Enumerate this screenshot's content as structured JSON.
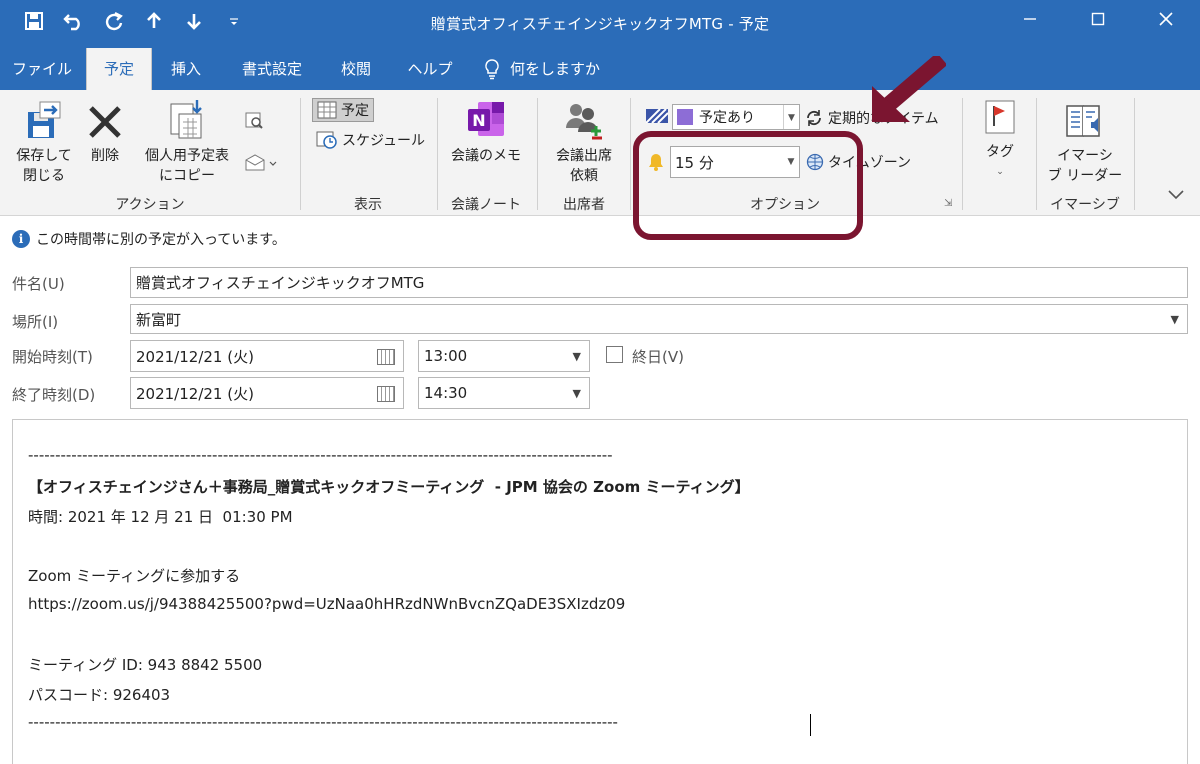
{
  "titlebar": {
    "title": "贈賞式オフィスチェインジキックオフMTG  -  予定",
    "qat_icons": [
      "save-icon",
      "undo-icon",
      "redo-icon",
      "up-arrow-icon",
      "down-arrow-icon",
      "customize-qat-icon"
    ]
  },
  "tabs": [
    {
      "label": "ファイル"
    },
    {
      "label": "予定"
    },
    {
      "label": "挿入"
    },
    {
      "label": "書式設定"
    },
    {
      "label": "校閲"
    },
    {
      "label": "ヘルプ"
    },
    {
      "label": "何をしますか"
    }
  ],
  "ribbon": {
    "actions": {
      "save_close": "保存して\n閉じる",
      "save_close_l1": "保存して",
      "save_close_l2": "閉じる",
      "delete": "削除",
      "copy_l1": "個人用予定表",
      "copy_l2": "にコピー",
      "group": "アクション"
    },
    "show": {
      "appointment": "予定",
      "schedule": "スケジュール",
      "group": "表示"
    },
    "notes": {
      "meeting_notes": "会議のメモ",
      "group": "会議ノート"
    },
    "attendees": {
      "l1": "会議出席",
      "l2": "依頼",
      "group": "出席者"
    },
    "options": {
      "show_as": "予定あり",
      "recurrence": "定期的なアイテム",
      "reminder": "15 分",
      "timezone": "タイムゾーン",
      "group": "オプション"
    },
    "tags": {
      "label": "タグ"
    },
    "immersive": {
      "l1": "イマーシ",
      "l2": "ブ リーダー",
      "group": "イマーシブ"
    }
  },
  "info": {
    "message": "この時間帯に別の予定が入っています。"
  },
  "form": {
    "subject_label": "件名(U)",
    "subject": "贈賞式オフィスチェインジキックオフMTG",
    "location_label": "場所(I)",
    "location": "新富町",
    "start_label": "開始時刻(T)",
    "start_date": "2021/12/21 (火)",
    "start_time": "13:00",
    "allday_label": "終日(V)",
    "end_label": "終了時刻(D)",
    "end_date": "2021/12/21 (火)",
    "end_time": "14:30"
  },
  "body": {
    "dashes": "------------------------------------------------------------------------------------------------------------",
    "heading": "【オフィスチェインジさん＋事務局_贈賞式キックオフミーティング  - JPM 協会の Zoom ミーティング】",
    "time": "時間: 2021 年 12 月 21 日  01:30 PM",
    "join_text": "Zoom ミーティングに参加する",
    "url": "https://zoom.us/j/94388425500?pwd=UzNaa0hHRzdNWnBvcnZQaDE3SXIzdz09",
    "meeting_id": "ミーティング ID: 943 8842 5500",
    "passcode": "パスコード: 926403",
    "dashes_end": "-------------------------------------------------------------------------------------------------------------"
  },
  "colors": {
    "accent": "#2b6cb8",
    "annotation": "#7b1530"
  }
}
